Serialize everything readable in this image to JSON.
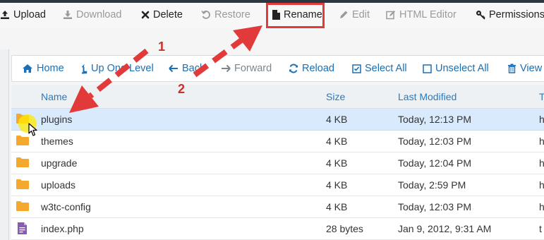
{
  "toolbar": {
    "upload": "Upload",
    "download": "Download",
    "delete": "Delete",
    "restore": "Restore",
    "rename": "Rename",
    "edit": "Edit",
    "html_editor": "HTML Editor",
    "permissions": "Permissions"
  },
  "navbar": {
    "home": "Home",
    "up_one_level": "Up One Level",
    "back": "Back",
    "forward": "Forward",
    "reload": "Reload",
    "select_all": "Select All",
    "unselect_all": "Unselect All",
    "view_trash": "View T"
  },
  "table": {
    "columns": {
      "name": "Name",
      "size": "Size",
      "last_modified": "Last Modified",
      "type": "T"
    },
    "rows": [
      {
        "name": "plugins",
        "size": "4 KB",
        "modified": "Today, 12:13 PM",
        "type": "h",
        "icon": "folder-icon",
        "selected": true
      },
      {
        "name": "themes",
        "size": "4 KB",
        "modified": "Today, 12:03 PM",
        "type": "h",
        "icon": "folder-icon"
      },
      {
        "name": "upgrade",
        "size": "4 KB",
        "modified": "Today, 12:04 PM",
        "type": "h",
        "icon": "folder-icon"
      },
      {
        "name": "uploads",
        "size": "4 KB",
        "modified": "Today, 2:59 PM",
        "type": "h",
        "icon": "folder-icon"
      },
      {
        "name": "w3tc-config",
        "size": "4 KB",
        "modified": "Today, 12:03 PM",
        "type": "h",
        "icon": "folder-icon"
      },
      {
        "name": "index.php",
        "size": "28 bytes",
        "modified": "Jan 9, 2012, 9:31 AM",
        "type": "t",
        "icon": "php-file-icon"
      }
    ]
  },
  "annotations": {
    "step1": "1",
    "step2": "2"
  },
  "colors": {
    "link_blue": "#1a6fb5",
    "selected_row": "#d8eafb",
    "folder": "#f4a92e",
    "annotation_red": "#e23a3a"
  }
}
